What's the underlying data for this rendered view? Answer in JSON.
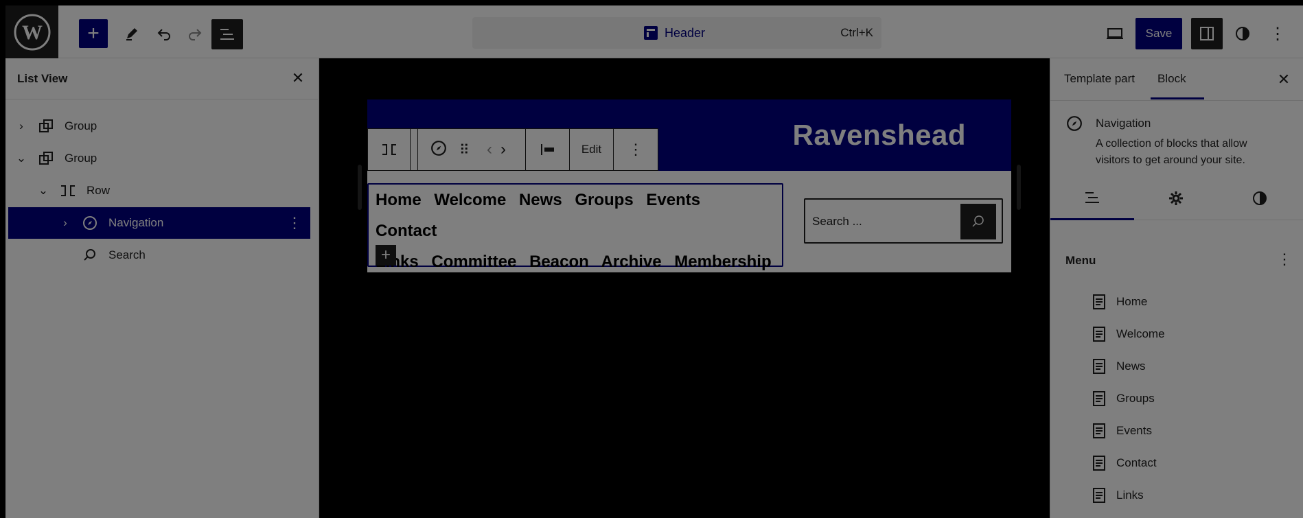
{
  "topbar": {
    "command_title": "Header",
    "command_shortcut": "Ctrl+K",
    "save_label": "Save"
  },
  "list_view": {
    "title": "List View",
    "items": [
      {
        "label": "Group"
      },
      {
        "label": "Group"
      },
      {
        "label": "Row"
      },
      {
        "label": "Navigation"
      },
      {
        "label": "Search"
      }
    ]
  },
  "canvas": {
    "site_title": "Ravenshead",
    "block_toolbar_edit": "Edit",
    "nav_items": [
      "Home",
      "Welcome",
      "News",
      "Groups",
      "Events",
      "Contact",
      "Links",
      "Committee",
      "Beacon",
      "Archive",
      "Membership"
    ],
    "search_placeholder": "Search ..."
  },
  "inspector": {
    "tab_template_part": "Template part",
    "tab_block": "Block",
    "block_title": "Navigation",
    "block_description": "A collection of blocks that allow visitors to get around your site.",
    "menu_heading": "Menu",
    "menu_items": [
      "Home",
      "Welcome",
      "News",
      "Groups",
      "Events",
      "Contact",
      "Links"
    ]
  },
  "colors": {
    "accent": "#000080",
    "dark": "#1e1e1e"
  }
}
